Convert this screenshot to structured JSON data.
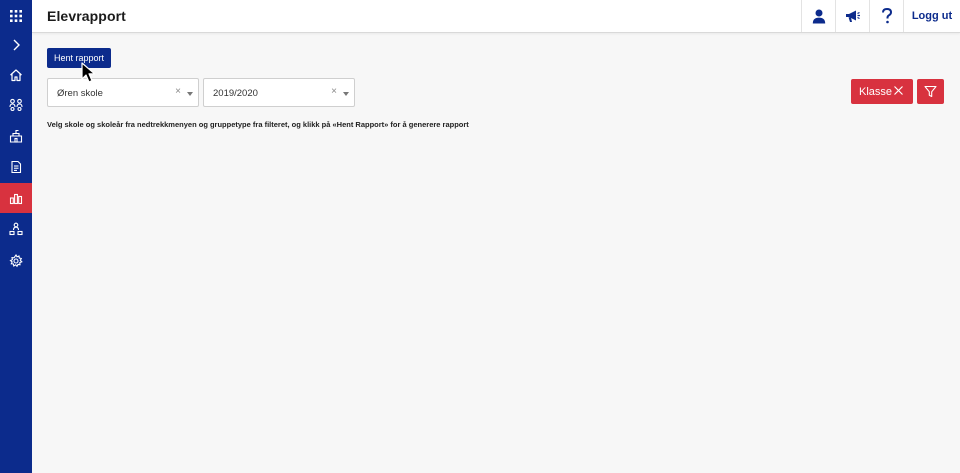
{
  "sidebar": {
    "items": [
      {
        "name": "apps-grid",
        "active": false
      },
      {
        "name": "expand",
        "active": false
      },
      {
        "name": "home",
        "active": false
      },
      {
        "name": "groups",
        "active": false
      },
      {
        "name": "school",
        "active": false
      },
      {
        "name": "document",
        "active": false
      },
      {
        "name": "reports",
        "active": true
      },
      {
        "name": "org-tree",
        "active": false
      },
      {
        "name": "settings",
        "active": false
      }
    ]
  },
  "header": {
    "title": "Elevrapport",
    "icons": [
      "user-icon",
      "megaphone-icon",
      "help-icon"
    ],
    "logout_label": "Logg ut"
  },
  "main": {
    "fetch_button_label": "Hent rapport",
    "school_select": {
      "value": "Øren skole",
      "clear": "×"
    },
    "year_select": {
      "value": "2019/2020",
      "clear": "×"
    },
    "group_chip": {
      "label": "Klasse"
    },
    "instruction": "Velg skole og skoleår fra nedtrekkmenyen og gruppetype fra filteret, og klikk på «Hent Rapport» for å generere rapport"
  },
  "colors": {
    "primary": "#0c2b8c",
    "accent": "#d8323f",
    "background": "#f7f7f7"
  }
}
